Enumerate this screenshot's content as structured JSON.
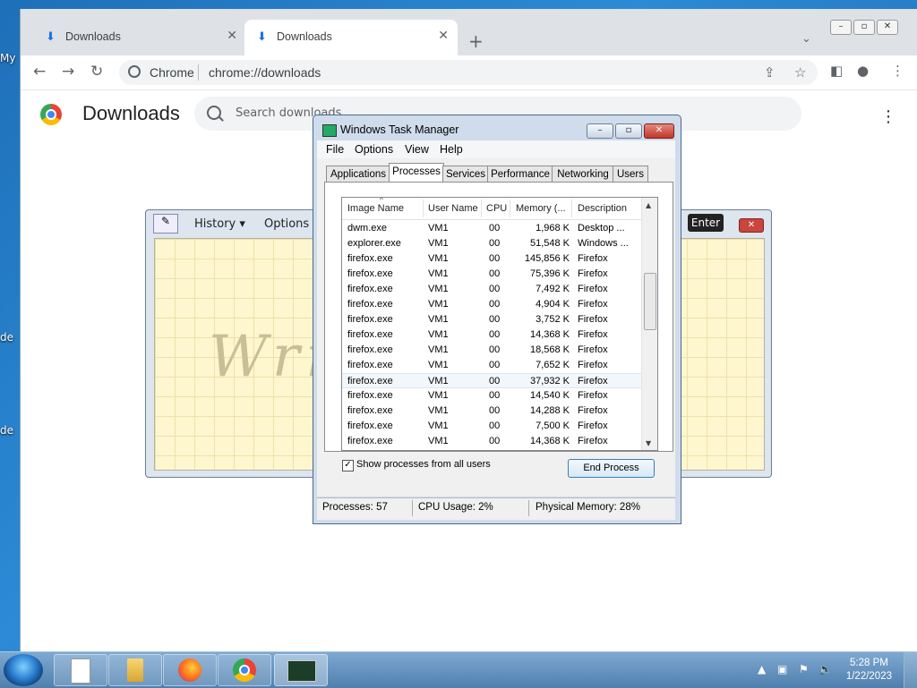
{
  "desktop": {
    "fragments": [
      "My",
      "de",
      "de"
    ]
  },
  "chrome": {
    "tabs": [
      {
        "label": "Downloads",
        "active": false
      },
      {
        "label": "Downloads",
        "active": true
      }
    ],
    "new_tab": "+",
    "tab_search": "⌄",
    "omnibox": {
      "site": "Chrome",
      "url": "chrome://downloads"
    },
    "page": {
      "title": "Downloads",
      "search_placeholder": "Search downloads"
    }
  },
  "handwriting": {
    "history_label": "History ▾",
    "options_label": "Options ▾",
    "enter_label": "Enter",
    "canvas_text": "Wri          re"
  },
  "task_manager": {
    "title": "Windows Task Manager",
    "menu": [
      "File",
      "Options",
      "View",
      "Help"
    ],
    "tabs": [
      "Applications",
      "Processes",
      "Services",
      "Performance",
      "Networking",
      "Users"
    ],
    "active_tab": "Processes",
    "columns": [
      "Image Name",
      "User Name",
      "CPU",
      "Memory (...",
      "Description"
    ],
    "rows": [
      [
        "dwm.exe",
        "VM1",
        "00",
        "1,968 K",
        "Desktop ..."
      ],
      [
        "explorer.exe",
        "VM1",
        "00",
        "51,548 K",
        "Windows ..."
      ],
      [
        "firefox.exe",
        "VM1",
        "00",
        "145,856 K",
        "Firefox"
      ],
      [
        "firefox.exe",
        "VM1",
        "00",
        "75,396 K",
        "Firefox"
      ],
      [
        "firefox.exe",
        "VM1",
        "00",
        "7,492 K",
        "Firefox"
      ],
      [
        "firefox.exe",
        "VM1",
        "00",
        "4,904 K",
        "Firefox"
      ],
      [
        "firefox.exe",
        "VM1",
        "00",
        "3,752 K",
        "Firefox"
      ],
      [
        "firefox.exe",
        "VM1",
        "00",
        "14,368 K",
        "Firefox"
      ],
      [
        "firefox.exe",
        "VM1",
        "00",
        "18,568 K",
        "Firefox"
      ],
      [
        "firefox.exe",
        "VM1",
        "00",
        "7,652 K",
        "Firefox"
      ],
      [
        "firefox.exe",
        "VM1",
        "00",
        "37,932 K",
        "Firefox"
      ],
      [
        "firefox.exe",
        "VM1",
        "00",
        "14,540 K",
        "Firefox"
      ],
      [
        "firefox.exe",
        "VM1",
        "00",
        "14,288 K",
        "Firefox"
      ],
      [
        "firefox.exe",
        "VM1",
        "00",
        "7,500 K",
        "Firefox"
      ],
      [
        "firefox.exe",
        "VM1",
        "00",
        "14,368 K",
        "Firefox"
      ]
    ],
    "show_all_label": "Show processes from all users",
    "show_all_checked": true,
    "end_process_label": "End Process",
    "status": {
      "processes": "Processes: 57",
      "cpu": "CPU Usage: 2%",
      "memory": "Physical Memory: 28%"
    }
  },
  "taskbar": {
    "apps": [
      "notepad-icon",
      "explorer-folder-icon",
      "firefox-icon",
      "chrome-icon",
      "task-manager-icon"
    ],
    "time": "5:28 PM",
    "date": "1/22/2023"
  },
  "colors": {
    "chrome_blue": "#1a73e8",
    "taskbar": "#5a88b6",
    "accent_close": "#c2352a"
  }
}
